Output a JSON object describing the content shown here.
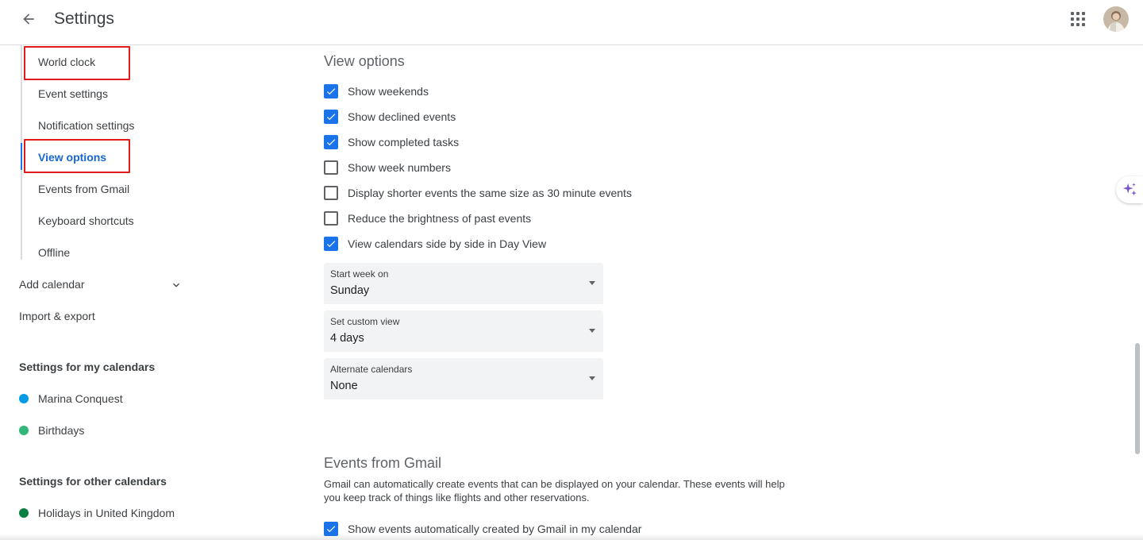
{
  "header": {
    "title": "Settings",
    "back_icon": "arrow-back-icon",
    "apps_icon": "apps-grid-icon",
    "avatar_icon": "user-avatar"
  },
  "sidebar": {
    "sub_items": [
      {
        "label": "World clock",
        "active": false,
        "highlighted": true
      },
      {
        "label": "Event settings",
        "active": false,
        "highlighted": false
      },
      {
        "label": "Notification settings",
        "active": false,
        "highlighted": false
      },
      {
        "label": "View options",
        "active": true,
        "highlighted": true
      },
      {
        "label": "Events from Gmail",
        "active": false,
        "highlighted": false
      },
      {
        "label": "Keyboard shortcuts",
        "active": false,
        "highlighted": false
      },
      {
        "label": "Offline",
        "active": false,
        "highlighted": false
      }
    ],
    "add_calendar": "Add calendar",
    "import_export": "Import & export",
    "my_calendars_heading": "Settings for my calendars",
    "my_calendars": [
      {
        "label": "Marina Conquest",
        "color": "#039be5"
      },
      {
        "label": "Birthdays",
        "color": "#33b679"
      }
    ],
    "other_calendars_heading": "Settings for other calendars",
    "other_calendars": [
      {
        "label": "Holidays in United Kingdom",
        "color": "#0b8043"
      }
    ]
  },
  "main": {
    "view_options": {
      "title": "View options",
      "checkboxes": [
        {
          "label": "Show weekends",
          "checked": true
        },
        {
          "label": "Show declined events",
          "checked": true
        },
        {
          "label": "Show completed tasks",
          "checked": true
        },
        {
          "label": "Show week numbers",
          "checked": false
        },
        {
          "label": "Display shorter events the same size as 30 minute events",
          "checked": false
        },
        {
          "label": "Reduce the brightness of past events",
          "checked": false
        },
        {
          "label": "View calendars side by side in Day View",
          "checked": true
        }
      ],
      "selects": [
        {
          "label": "Start week on",
          "value": "Sunday"
        },
        {
          "label": "Set custom view",
          "value": "4 days"
        },
        {
          "label": "Alternate calendars",
          "value": "None"
        }
      ]
    },
    "events_from_gmail": {
      "title": "Events from Gmail",
      "description": "Gmail can automatically create events that can be displayed on your calendar. These events will help you keep track of things like flights and other reservations.",
      "checkbox": {
        "label": "Show events automatically created by Gmail in my calendar",
        "checked": true
      }
    }
  },
  "colors": {
    "accent": "#1a73e8",
    "highlight_box": "#e01b1b",
    "text": "#3c4043"
  }
}
